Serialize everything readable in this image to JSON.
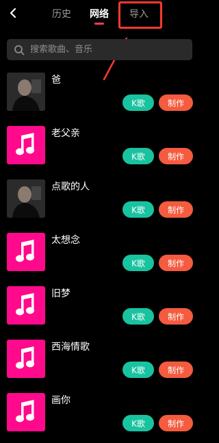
{
  "header": {
    "back_icon": "chevron-left-icon",
    "tabs": [
      {
        "label": "历史",
        "active": false
      },
      {
        "label": "网络",
        "active": true
      },
      {
        "label": "导入",
        "active": false
      }
    ],
    "accent_color": "#ff3b5c",
    "annotation_color": "#ff3a2f"
  },
  "search": {
    "placeholder": "搜索歌曲、音乐",
    "value": "",
    "icon": "search-icon"
  },
  "buttons": {
    "k_label": "K歌",
    "make_label": "制作",
    "k_color": "#19c3a0",
    "make_color": "#f45b3f"
  },
  "songs": [
    {
      "title": "爸",
      "cover": "photo"
    },
    {
      "title": "老父亲",
      "cover": "music-note-icon"
    },
    {
      "title": "点歌的人",
      "cover": "photo"
    },
    {
      "title": "太想念",
      "cover": "music-note-icon"
    },
    {
      "title": "旧梦",
      "cover": "music-note-icon"
    },
    {
      "title": "西海情歌",
      "cover": "music-note-icon"
    },
    {
      "title": "画你",
      "cover": "music-note-icon"
    }
  ]
}
